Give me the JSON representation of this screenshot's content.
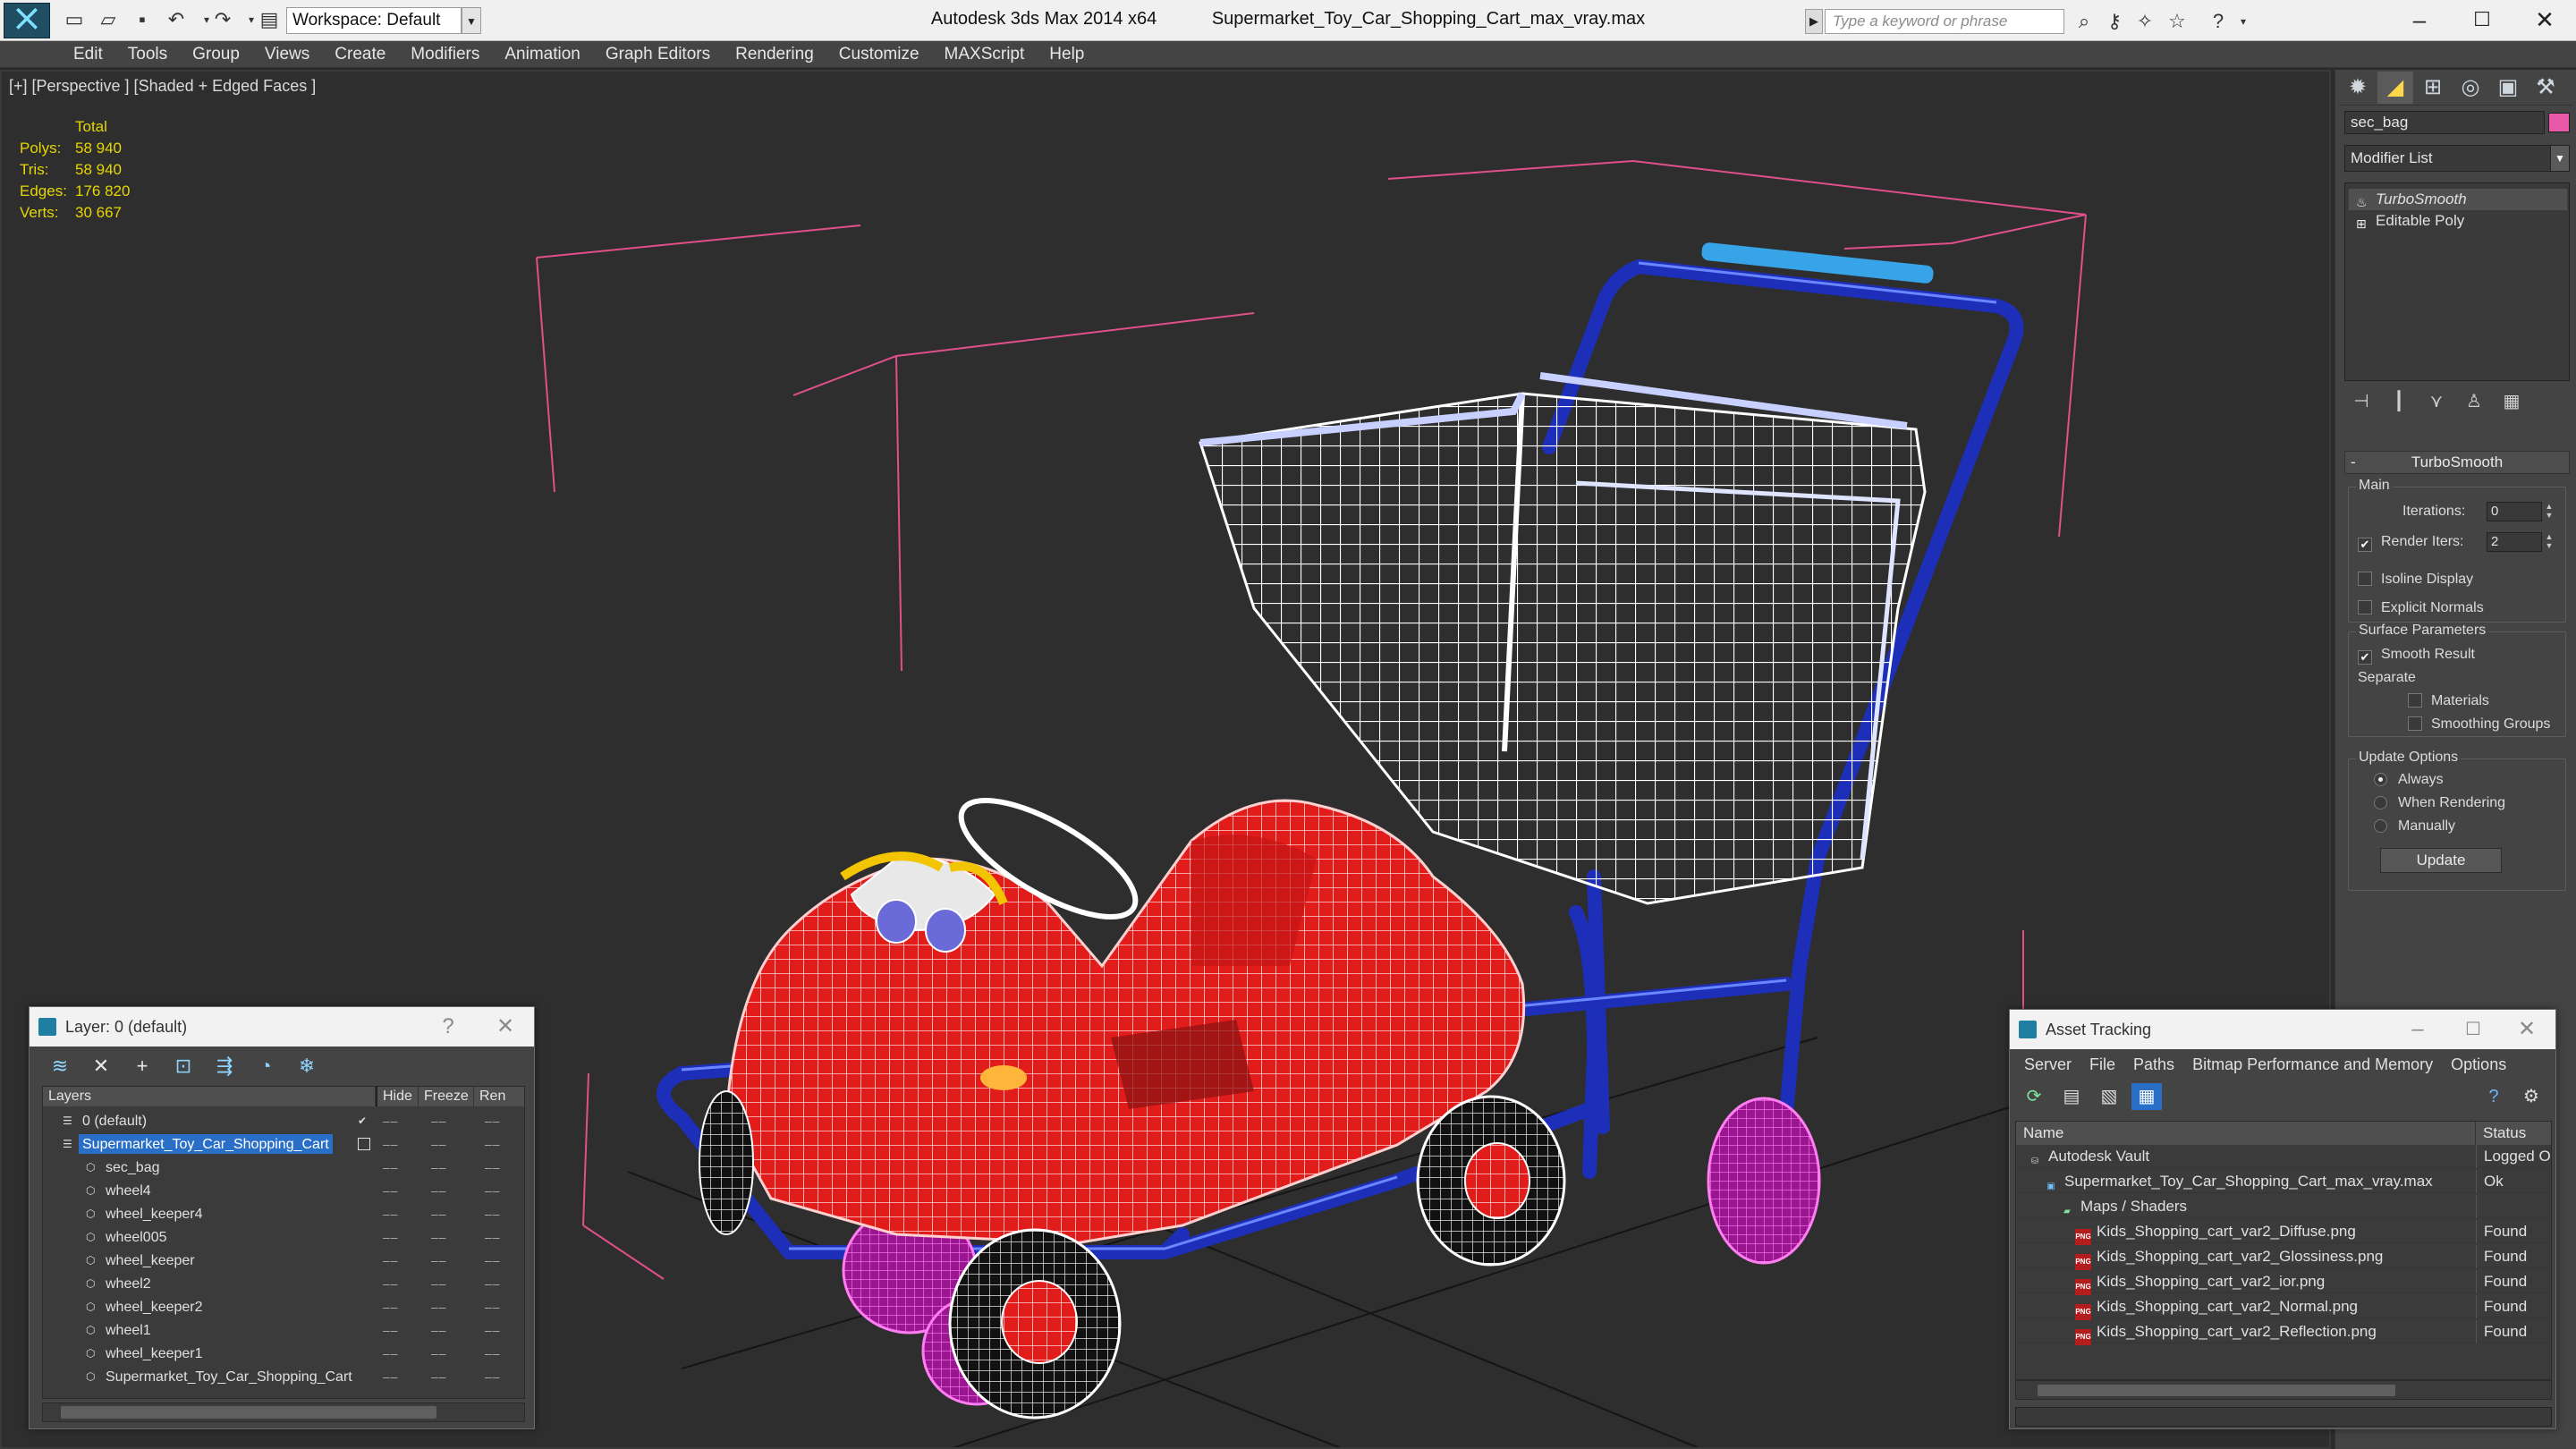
{
  "titlebar": {
    "app_title": "Autodesk 3ds Max  2014 x64",
    "file_name": "Supermarket_Toy_Car_Shopping_Cart_max_vray.max",
    "workspace": "Workspace: Default",
    "search_placeholder": "Type a keyword or phrase"
  },
  "menu": [
    "Edit",
    "Tools",
    "Group",
    "Views",
    "Create",
    "Modifiers",
    "Animation",
    "Graph Editors",
    "Rendering",
    "Customize",
    "MAXScript",
    "Help"
  ],
  "viewport": {
    "label": "[+] [Perspective ] [Shaded + Edged Faces ]",
    "stats_header": "Total",
    "stats": [
      {
        "key": "Polys:",
        "value": "58 940"
      },
      {
        "key": "Tris:",
        "value": "58 940"
      },
      {
        "key": "Edges:",
        "value": "176 820"
      },
      {
        "key": "Verts:",
        "value": "30 667"
      }
    ]
  },
  "command_panel": {
    "object_name": "sec_bag",
    "object_color": "#e85aa8",
    "modifier_list": "Modifier List",
    "stack": [
      "TurboSmooth",
      "Editable Poly"
    ],
    "rollout_title": "TurboSmooth",
    "main_group": "Main",
    "iterations_label": "Iterations:",
    "iterations_value": "0",
    "render_iters_label": "Render Iters:",
    "render_iters_value": "2",
    "isoline": "Isoline Display",
    "explicit_normals": "Explicit Normals",
    "surface_group": "Surface Parameters",
    "smooth_result": "Smooth Result",
    "separate": "Separate",
    "materials": "Materials",
    "smoothing_groups": "Smoothing Groups",
    "update_group": "Update Options",
    "always": "Always",
    "when_rendering": "When Rendering",
    "manually": "Manually",
    "update_button": "Update"
  },
  "layer_dialog": {
    "title": "Layer: 0 (default)",
    "help": "?",
    "columns": [
      "Layers",
      "Hide",
      "Freeze",
      "Ren"
    ],
    "rows": [
      {
        "name": "0 (default)",
        "indent": 0
      },
      {
        "name": "Supermarket_Toy_Car_Shopping_Cart",
        "indent": 0
      },
      {
        "name": "sec_bag",
        "indent": 1
      },
      {
        "name": "wheel4",
        "indent": 1
      },
      {
        "name": "wheel_keeper4",
        "indent": 1
      },
      {
        "name": "wheel005",
        "indent": 1
      },
      {
        "name": "wheel_keeper",
        "indent": 1
      },
      {
        "name": "wheel2",
        "indent": 1
      },
      {
        "name": "wheel_keeper2",
        "indent": 1
      },
      {
        "name": "wheel1",
        "indent": 1
      },
      {
        "name": "wheel_keeper1",
        "indent": 1
      },
      {
        "name": "Supermarket_Toy_Car_Shopping_Cart",
        "indent": 1
      }
    ]
  },
  "asset_dialog": {
    "title": "Asset Tracking",
    "menu": [
      "Server",
      "File",
      "Paths",
      "Bitmap Performance and Memory",
      "Options"
    ],
    "columns": [
      "Name",
      "Status"
    ],
    "rows": [
      {
        "name": "Autodesk Vault",
        "status": "Logged O",
        "level": 0,
        "icon": "vault"
      },
      {
        "name": "Supermarket_Toy_Car_Shopping_Cart_max_vray.max",
        "status": "Ok",
        "level": 1,
        "icon": "max"
      },
      {
        "name": "Maps / Shaders",
        "status": "",
        "level": 2,
        "icon": "maps"
      },
      {
        "name": "Kids_Shopping_cart_var2_Diffuse.png",
        "status": "Found",
        "level": 3,
        "icon": "png"
      },
      {
        "name": "Kids_Shopping_cart_var2_Glossiness.png",
        "status": "Found",
        "level": 3,
        "icon": "png"
      },
      {
        "name": "Kids_Shopping_cart_var2_ior.png",
        "status": "Found",
        "level": 3,
        "icon": "png"
      },
      {
        "name": "Kids_Shopping_cart_var2_Normal.png",
        "status": "Found",
        "level": 3,
        "icon": "png"
      },
      {
        "name": "Kids_Shopping_cart_var2_Reflection.png",
        "status": "Found",
        "level": 3,
        "icon": "png"
      }
    ]
  }
}
